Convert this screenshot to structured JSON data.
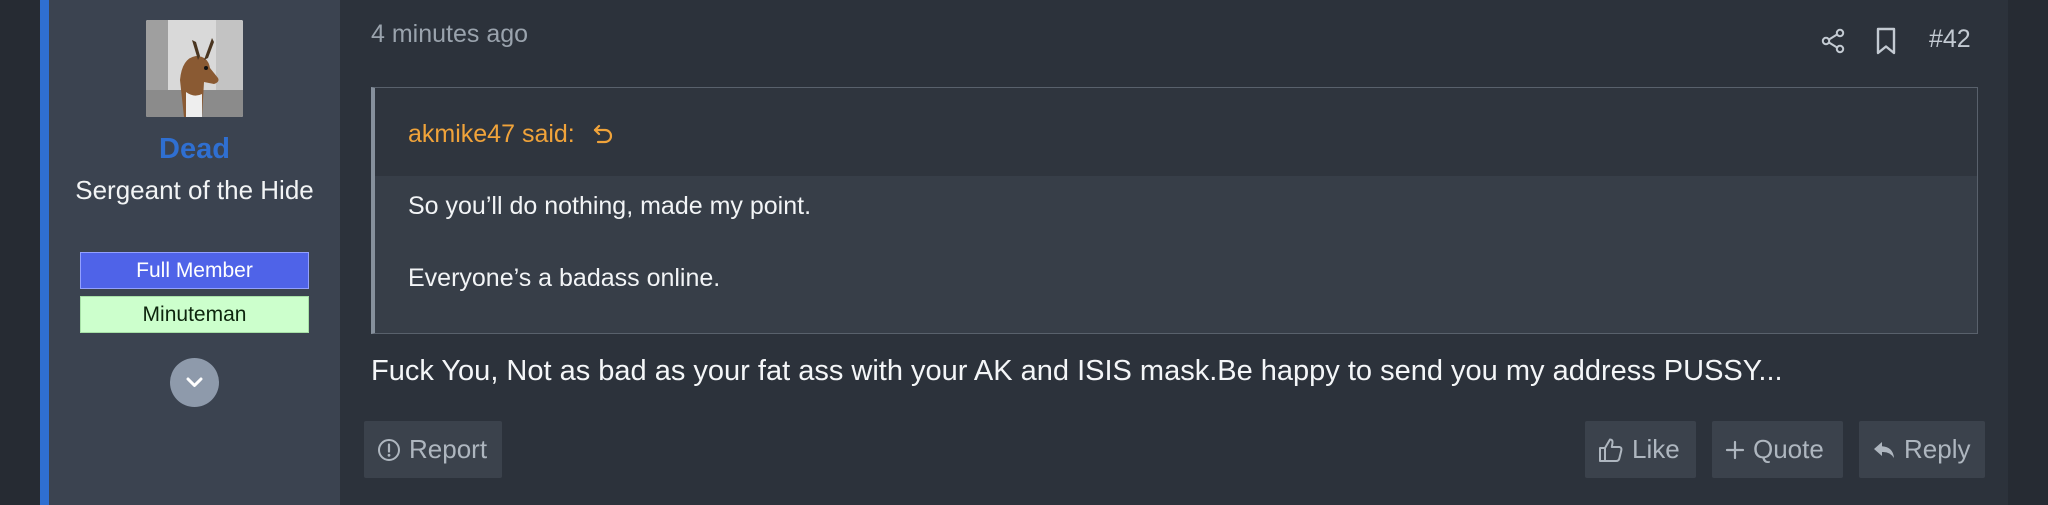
{
  "user": {
    "username": "Dead",
    "title": "Sergeant of the Hide",
    "banners": [
      "Full Member",
      "Minuteman"
    ]
  },
  "post": {
    "time": "4 minutes ago",
    "number": "#42",
    "quote": {
      "author_label": "akmike47 said:",
      "lines": [
        "So you’ll do nothing, made my point.",
        "Everyone’s a badass online."
      ]
    },
    "body": "Fuck You, Not as bad as your fat ass with your AK and ISIS mask.Be happy to send you my address PUSSY..."
  },
  "actions": {
    "report": "Report",
    "like": "Like",
    "quote": "Quote",
    "reply": "Reply"
  },
  "icons": {
    "share": "share-icon",
    "bookmark": "bookmark-icon",
    "quote_return": "return-arrow-icon",
    "expand": "chevron-down-icon",
    "report": "alert-circle-icon",
    "like": "thumbs-up-icon",
    "quote": "plus-icon",
    "reply": "reply-arrow-icon"
  },
  "colors": {
    "accent": "#2f6fd1",
    "username": "#2f6fd1",
    "quote_author": "#f0a33a",
    "banner_member": "#4f63e8",
    "banner_minuteman": "#ccffcc"
  }
}
